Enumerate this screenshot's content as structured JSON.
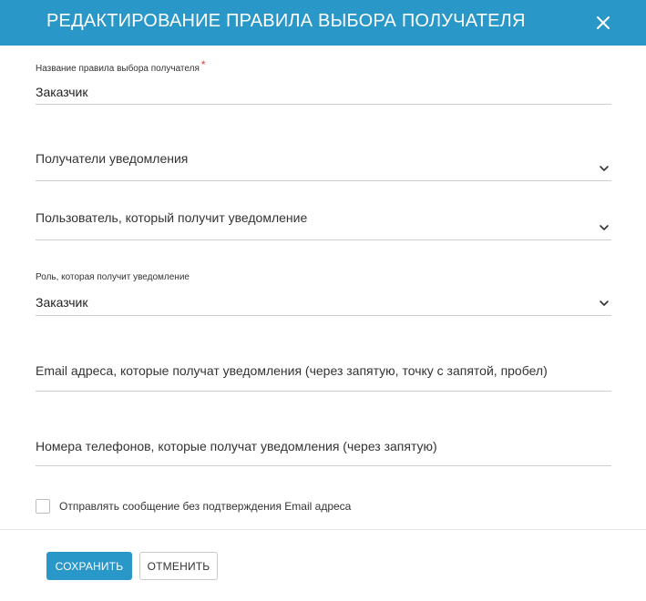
{
  "dialog": {
    "title": "РЕДАКТИРОВАНИЕ ПРАВИЛА ВЫБОРА ПОЛУЧАТЕЛЯ",
    "close_icon": "close-icon"
  },
  "fields": {
    "rule_name": {
      "label": "Название правила выбора получателя",
      "required_mark": "*",
      "value": "Заказчик"
    },
    "notification_recipients": {
      "placeholder": "Получатели уведомления",
      "icon": "chevron-down-icon"
    },
    "user_recipient": {
      "placeholder": "Пользователь, который получит уведомление",
      "icon": "chevron-down-icon"
    },
    "role_recipient": {
      "label": "Роль, которая получит уведомление",
      "value": "Заказчик",
      "icon": "chevron-down-icon"
    },
    "emails": {
      "placeholder": "Email адреса, которые получат уведомления (через запятую, точку с запятой, пробел)"
    },
    "phones": {
      "placeholder": "Номера телефонов, которые получат уведомления (через запятую)"
    },
    "send_without_confirmation": {
      "label": "Отправлять сообщение без подтверждения Email адреса",
      "checked": false
    }
  },
  "footer": {
    "save_label": "СОХРАНИТЬ",
    "cancel_label": "ОТМЕНИТЬ"
  },
  "colors": {
    "accent": "#2a97c9",
    "required": "#e53935",
    "divider": "#cfcfcf"
  }
}
